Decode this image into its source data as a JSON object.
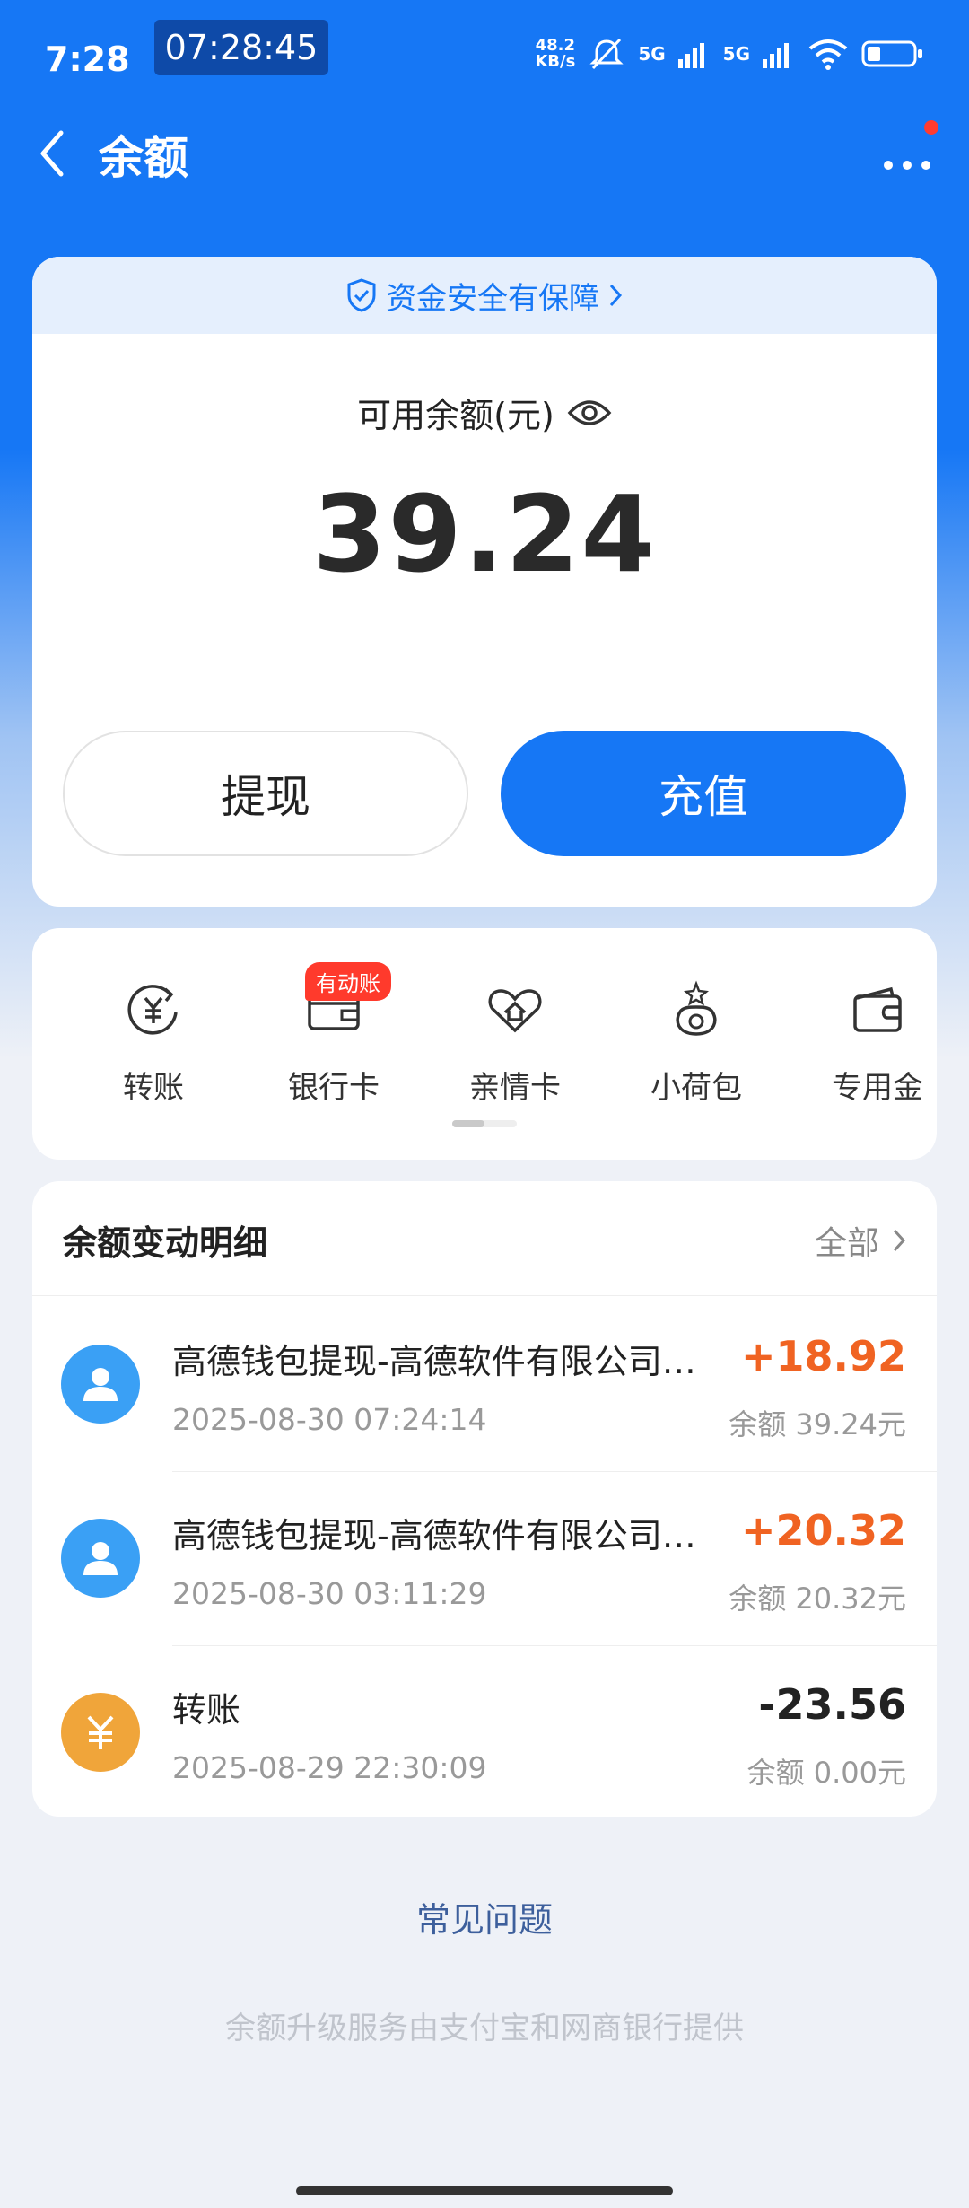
{
  "status_bar": {
    "time": "7:28",
    "clock": "07:28:45",
    "speed_value": "48.2",
    "speed_unit": "KB/s",
    "network1": "5G",
    "network2": "5G"
  },
  "header": {
    "title": "余额"
  },
  "balance": {
    "safety_text": "资金安全有保障",
    "available_label": "可用余额(元)",
    "amount": "39.24",
    "withdraw_label": "提现",
    "recharge_label": "充值"
  },
  "actions": {
    "items": [
      {
        "label": "转账",
        "icon": "yuan-transfer-icon"
      },
      {
        "label": "银行卡",
        "icon": "wallet-card-icon"
      },
      {
        "label": "亲情卡",
        "icon": "heart-home-icon"
      },
      {
        "label": "小荷包",
        "icon": "pouch-icon"
      },
      {
        "label": "专用金",
        "icon": "wallet-icon"
      }
    ],
    "badge": "有动账"
  },
  "transactions": {
    "title": "余额变动明细",
    "all_label": "全部",
    "rows": [
      {
        "name": "高德钱包提现-高德软件有限公司（高德地图）",
        "date": "2025-08-30 07:24:14",
        "amount": "+18.92",
        "balance": "余额 39.24元",
        "icon": "user-avatar-icon"
      },
      {
        "name": "高德钱包提现-高德软件有限公司（高德地图）",
        "date": "2025-08-30 03:11:29",
        "amount": "+20.32",
        "balance": "余额 20.32元",
        "icon": "user-avatar-icon"
      },
      {
        "name": "转账",
        "date": "2025-08-29 22:30:09",
        "amount": "-23.56",
        "balance": "余额 0.00元",
        "icon": "yuan-icon"
      }
    ]
  },
  "faq_label": "常见问题",
  "footer_note": "余额升级服务由支付宝和网商银行提供",
  "colors": {
    "primary": "#1677f5",
    "positive": "#f06322",
    "avatar_blue": "#3aa0f5",
    "avatar_orange": "#f0a53a"
  }
}
